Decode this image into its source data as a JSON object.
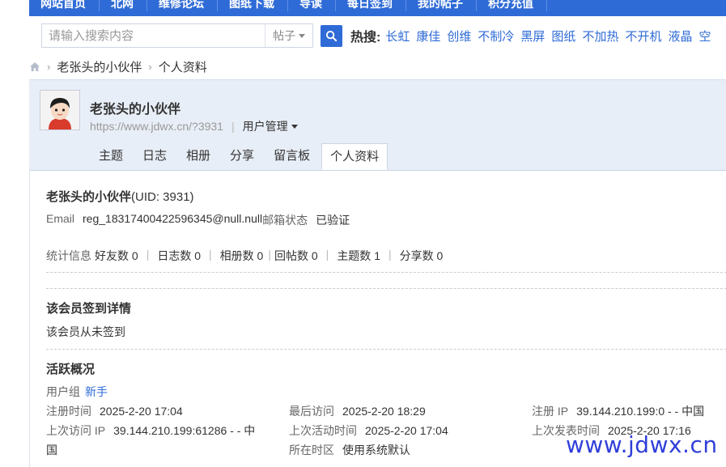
{
  "topnav": {
    "items": [
      "网站首页",
      "北网",
      "维修论坛",
      "图纸下载",
      "导读",
      "每日签到",
      "我的帖子",
      "积分充值"
    ]
  },
  "search": {
    "placeholder": "请输入搜索内容",
    "type": "帖子",
    "hot_label": "热搜:",
    "hot_links": [
      "长虹",
      "康佳",
      "创维",
      "不制冷",
      "黑屏",
      "图纸",
      "不加热",
      "不开机",
      "液晶",
      "空"
    ]
  },
  "breadcrumb": {
    "items": [
      "老张头的小伙伴",
      "个人资料"
    ]
  },
  "profile": {
    "name": "老张头的小伙伴",
    "url": "https://www.jdwx.cn/?3931",
    "manage_label": "用户管理",
    "tabs": [
      "主题",
      "日志",
      "相册",
      "分享",
      "留言板",
      "个人资料"
    ],
    "active_tab": "个人资料"
  },
  "info": {
    "name": "老张头的小伙伴",
    "uid": "(UID: 3931)",
    "email_label": "Email",
    "email_value": "reg_18317400422596345@null.null",
    "email_status_label": "邮箱状态",
    "email_status_value": "已验证",
    "stats_label": "统计信息",
    "stats": [
      {
        "label": "好友数",
        "value": "0"
      },
      {
        "label": "日志数",
        "value": "0"
      },
      {
        "label": "相册数",
        "value": "0"
      },
      {
        "label": "回帖数",
        "value": "0"
      },
      {
        "label": "主题数",
        "value": "1"
      },
      {
        "label": "分享数",
        "value": "0"
      }
    ]
  },
  "signin": {
    "title": "该会员签到详情",
    "text": "该会员从未签到"
  },
  "activity": {
    "title": "活跃概况",
    "usergroup_label": "用户组",
    "usergroup_value": "新手",
    "reg_time_label": "注册时间",
    "reg_time": "2025-2-20 17:04",
    "last_visit_label": "最后访问",
    "last_visit": "2025-2-20 18:29",
    "reg_ip_label": "注册 IP",
    "reg_ip": "39.144.210.199:0 - - 中国",
    "last_ip_label": "上次访问 IP",
    "last_ip_line1": "39.144.210.199:61286 - - 中",
    "last_ip_line2": "国",
    "last_active_label": "上次活动时间",
    "last_active": "2025-2-20 17:04",
    "last_post_label": "上次发表时间",
    "last_post": "2025-2-20 17:16",
    "timezone_label": "所在时区",
    "timezone": "使用系统默认"
  },
  "watermark": "www.jdwx.cn",
  "colors": {
    "accent": "#2f6bd6",
    "header_bg": "#e8eef7"
  }
}
